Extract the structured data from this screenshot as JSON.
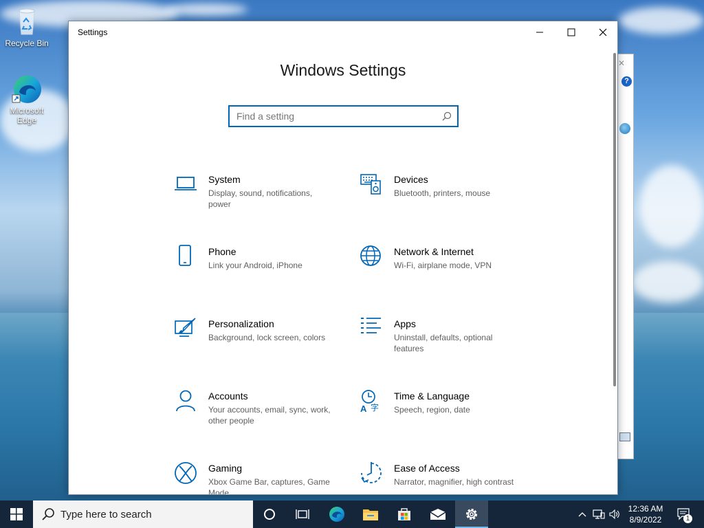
{
  "desktop": {
    "icons": [
      {
        "label": "Recycle Bin",
        "icon": "recycle-bin-icon"
      },
      {
        "label": "Microsoft Edge",
        "icon": "edge-icon"
      }
    ]
  },
  "window": {
    "title": "Settings",
    "heading": "Windows Settings",
    "search_placeholder": "Find a setting",
    "categories": [
      {
        "name": "System",
        "desc": "Display, sound, notifications, power",
        "icon": "laptop-icon"
      },
      {
        "name": "Devices",
        "desc": "Bluetooth, printers, mouse",
        "icon": "keyboard-speaker-icon"
      },
      {
        "name": "Phone",
        "desc": "Link your Android, iPhone",
        "icon": "phone-icon"
      },
      {
        "name": "Network & Internet",
        "desc": "Wi-Fi, airplane mode, VPN",
        "icon": "globe-icon"
      },
      {
        "name": "Personalization",
        "desc": "Background, lock screen, colors",
        "icon": "paint-brush-icon"
      },
      {
        "name": "Apps",
        "desc": "Uninstall, defaults, optional features",
        "icon": "apps-list-icon"
      },
      {
        "name": "Accounts",
        "desc": "Your accounts, email, sync, work, other people",
        "icon": "person-icon"
      },
      {
        "name": "Time & Language",
        "desc": "Speech, region, date",
        "icon": "time-language-icon"
      },
      {
        "name": "Gaming",
        "desc": "Xbox Game Bar, captures, Game Mode",
        "icon": "xbox-icon"
      },
      {
        "name": "Ease of Access",
        "desc": "Narrator, magnifier, high contrast",
        "icon": "ease-of-access-icon"
      }
    ]
  },
  "taskbar": {
    "search_label": "Type here to search",
    "time": "12:36 AM",
    "date": "8/9/2022",
    "notification_count": "1"
  },
  "colors": {
    "accent": "#0067b8",
    "taskbar": "#16263a"
  }
}
